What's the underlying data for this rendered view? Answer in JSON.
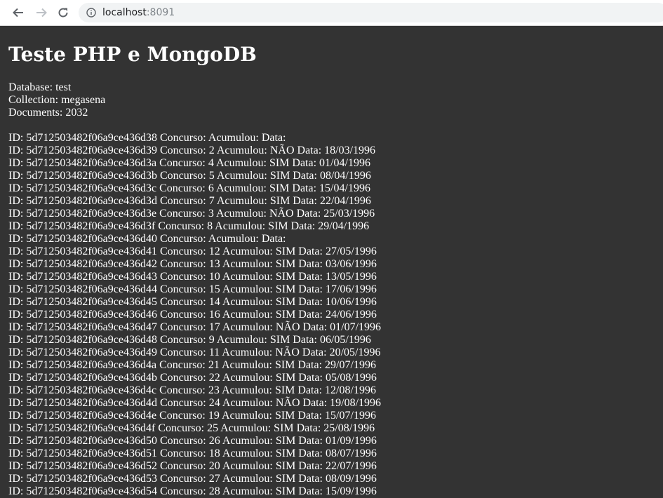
{
  "browser": {
    "url_host": "localhost",
    "url_port": ":8091"
  },
  "page": {
    "title": "Teste PHP e MongoDB",
    "database": "Database: test",
    "collection": "Collection: megasena",
    "documents": "Documents: 2032"
  },
  "rows": [
    "ID: 5d712503482f06a9ce436d38 Concurso: Acumulou: Data:",
    "ID: 5d712503482f06a9ce436d39 Concurso: 2 Acumulou: NÃO Data: 18/03/1996",
    "ID: 5d712503482f06a9ce436d3a Concurso: 4 Acumulou: SIM Data: 01/04/1996",
    "ID: 5d712503482f06a9ce436d3b Concurso: 5 Acumulou: SIM Data: 08/04/1996",
    "ID: 5d712503482f06a9ce436d3c Concurso: 6 Acumulou: SIM Data: 15/04/1996",
    "ID: 5d712503482f06a9ce436d3d Concurso: 7 Acumulou: SIM Data: 22/04/1996",
    "ID: 5d712503482f06a9ce436d3e Concurso: 3 Acumulou: NÃO Data: 25/03/1996",
    "ID: 5d712503482f06a9ce436d3f Concurso: 8 Acumulou: SIM Data: 29/04/1996",
    "ID: 5d712503482f06a9ce436d40 Concurso: Acumulou: Data:",
    "ID: 5d712503482f06a9ce436d41 Concurso: 12 Acumulou: SIM Data: 27/05/1996",
    "ID: 5d712503482f06a9ce436d42 Concurso: 13 Acumulou: SIM Data: 03/06/1996",
    "ID: 5d712503482f06a9ce436d43 Concurso: 10 Acumulou: SIM Data: 13/05/1996",
    "ID: 5d712503482f06a9ce436d44 Concurso: 15 Acumulou: SIM Data: 17/06/1996",
    "ID: 5d712503482f06a9ce436d45 Concurso: 14 Acumulou: SIM Data: 10/06/1996",
    "ID: 5d712503482f06a9ce436d46 Concurso: 16 Acumulou: SIM Data: 24/06/1996",
    "ID: 5d712503482f06a9ce436d47 Concurso: 17 Acumulou: NÃO Data: 01/07/1996",
    "ID: 5d712503482f06a9ce436d48 Concurso: 9 Acumulou: SIM Data: 06/05/1996",
    "ID: 5d712503482f06a9ce436d49 Concurso: 11 Acumulou: NÃO Data: 20/05/1996",
    "ID: 5d712503482f06a9ce436d4a Concurso: 21 Acumulou: SIM Data: 29/07/1996",
    "ID: 5d712503482f06a9ce436d4b Concurso: 22 Acumulou: SIM Data: 05/08/1996",
    "ID: 5d712503482f06a9ce436d4c Concurso: 23 Acumulou: SIM Data: 12/08/1996",
    "ID: 5d712503482f06a9ce436d4d Concurso: 24 Acumulou: NÃO Data: 19/08/1996",
    "ID: 5d712503482f06a9ce436d4e Concurso: 19 Acumulou: SIM Data: 15/07/1996",
    "ID: 5d712503482f06a9ce436d4f Concurso: 25 Acumulou: SIM Data: 25/08/1996",
    "ID: 5d712503482f06a9ce436d50 Concurso: 26 Acumulou: SIM Data: 01/09/1996",
    "ID: 5d712503482f06a9ce436d51 Concurso: 18 Acumulou: SIM Data: 08/07/1996",
    "ID: 5d712503482f06a9ce436d52 Concurso: 20 Acumulou: SIM Data: 22/07/1996",
    "ID: 5d712503482f06a9ce436d53 Concurso: 27 Acumulou: SIM Data: 08/09/1996",
    "ID: 5d712503482f06a9ce436d54 Concurso: 28 Acumulou: SIM Data: 15/09/1996"
  ],
  "colors": {
    "page_background": "#333333",
    "text": "#ffffff",
    "toolbar_background": "#ffffff",
    "omnibox_background": "#f1f3f4"
  },
  "icons": [
    "back-arrow-icon",
    "forward-arrow-icon",
    "reload-icon",
    "info-icon"
  ]
}
